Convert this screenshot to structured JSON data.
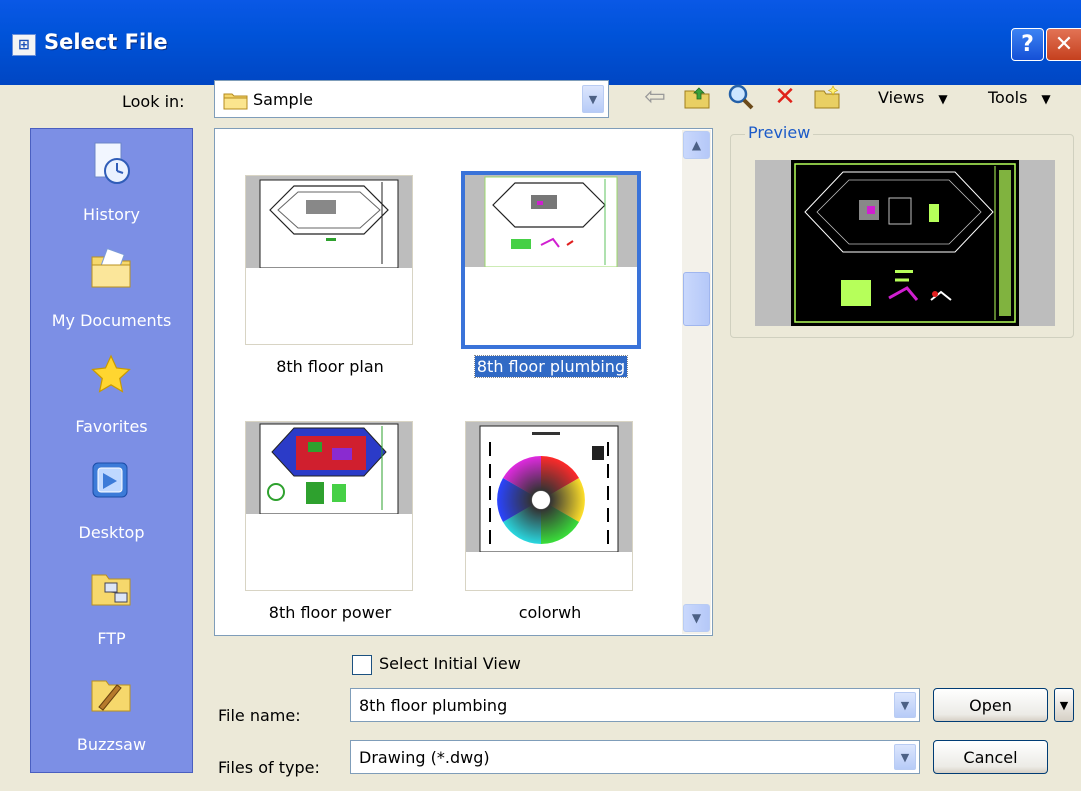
{
  "window": {
    "title": "Select File",
    "help_label": "?",
    "close_label": "✕"
  },
  "lookin": {
    "label": "Look in:",
    "value": "Sample"
  },
  "toolbar": {
    "views_label": "Views",
    "tools_label": "Tools",
    "back_icon": "back-arrow-icon",
    "up_folder_icon": "up-folder-icon",
    "search_icon": "search-web-icon",
    "delete_icon": "delete-icon",
    "new_folder_icon": "create-folder-icon"
  },
  "places": [
    {
      "label": "History",
      "icon": "history-icon"
    },
    {
      "label": "My Documents",
      "icon": "my-documents-icon"
    },
    {
      "label": "Favorites",
      "icon": "favorites-icon"
    },
    {
      "label": "Desktop",
      "icon": "desktop-icon"
    },
    {
      "label": "FTP",
      "icon": "ftp-icon"
    },
    {
      "label": "Buzzsaw",
      "icon": "buzzsaw-icon"
    }
  ],
  "files": [
    {
      "name": "8th floor plan",
      "selected": false
    },
    {
      "name": "8th floor plumbing",
      "selected": true
    },
    {
      "name": "8th floor power",
      "selected": false
    },
    {
      "name": "colorwh",
      "selected": false
    }
  ],
  "preview": {
    "label": "Preview"
  },
  "select_initial_view": {
    "label": "Select Initial View",
    "checked": false
  },
  "file_name": {
    "label": "File name:",
    "value": "8th floor plumbing"
  },
  "file_type": {
    "label": "Files of type:",
    "value": "Drawing (*.dwg)"
  },
  "buttons": {
    "open": "Open",
    "cancel": "Cancel"
  },
  "colors": {
    "titlebar": "#0053D9",
    "places_bg": "#7C8FE5",
    "dialog_bg": "#ECE9D8",
    "selection": "#316AC5",
    "drawing_bg": "#000000",
    "drawing_line": "#B6FF5A"
  }
}
